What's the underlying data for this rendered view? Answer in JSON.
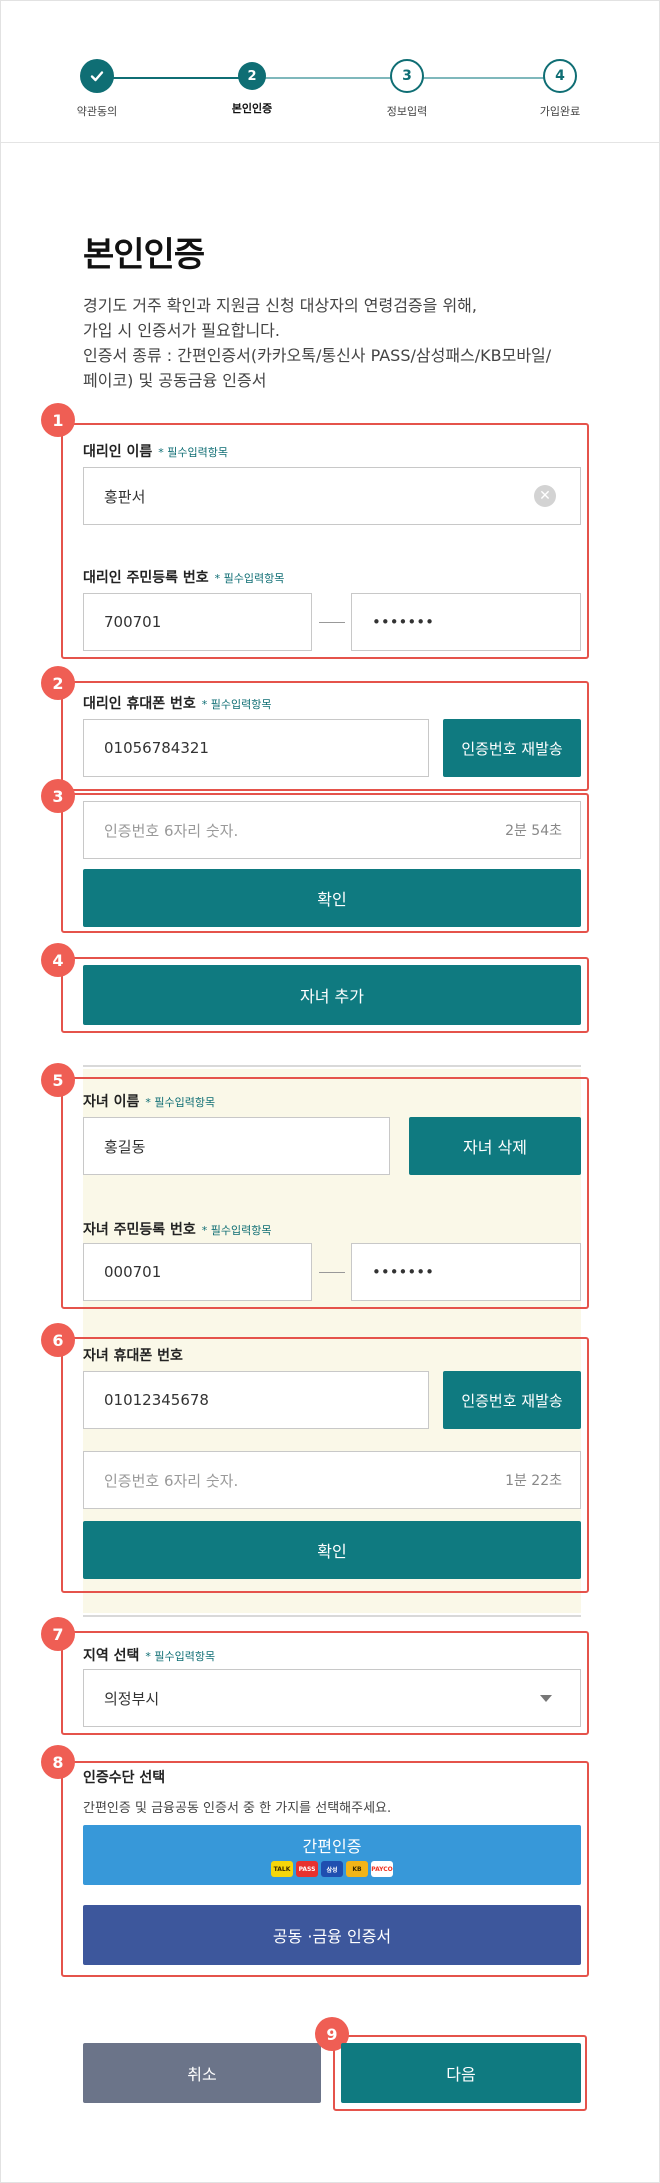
{
  "stepper": {
    "steps": [
      {
        "num": "",
        "label": "약관동의"
      },
      {
        "num": "2",
        "label": "본인인증"
      },
      {
        "num": "3",
        "label": "정보입력"
      },
      {
        "num": "4",
        "label": "가입완료"
      }
    ]
  },
  "page": {
    "title": "본인인증",
    "desc_line1": "경기도 거주 확인과 지원금 신청 대상자의 연령검증을 위해,",
    "desc_line2": "가입 시 인증서가 필요합니다.",
    "desc_line3": "인증서 종류 : 간편인증서(카카오톡/통신사 PASS/삼성패스/KB모바일/",
    "desc_line4": "페이코) 및 공동금융 인증서"
  },
  "badges": [
    "1",
    "2",
    "3",
    "4",
    "5",
    "6",
    "7",
    "8",
    "9"
  ],
  "required_text": "필수입력항목",
  "agent": {
    "name_label": "대리인 이름",
    "name_value": "홍판서",
    "rrn_label": "대리인 주민등록 번호",
    "rrn_front": "700701",
    "rrn_back": "•••••••",
    "phone_label": "대리인 휴대폰 번호",
    "phone_value": "01056784321",
    "resend_label": "인증번호 재발송",
    "code_placeholder": "인증번호 6자리 숫자.",
    "timer": "2분 54초",
    "confirm_label": "확인",
    "add_child_label": "자녀 추가"
  },
  "child": {
    "name_label": "자녀 이름",
    "name_value": "홍길동",
    "delete_label": "자녀 삭제",
    "rrn_label": "자녀 주민등록 번호",
    "rrn_front": "000701",
    "rrn_back": "•••••••",
    "phone_label": "자녀 휴대폰 번호",
    "phone_value": "01012345678",
    "resend_label": "인증번호 재발송",
    "code_placeholder": "인증번호 6자리 숫자.",
    "timer": "1분 22초",
    "confirm_label": "확인"
  },
  "region": {
    "label": "지역 선택",
    "value": "의정부시"
  },
  "auth": {
    "label": "인증수단 선택",
    "desc": "간편인증 및 금융공동 인증서 중 한 가지를 선택해주세요.",
    "easy_label": "간편인증",
    "easy_icons": [
      "TALK",
      "PASS",
      "삼성",
      "KB",
      "PAYCO"
    ],
    "cert_label": "공동 ·금융 인증서"
  },
  "footer": {
    "cancel_label": "취소",
    "next_label": "다음"
  },
  "colors": {
    "teal": "#0f7a80",
    "annotation_red": "#e5534b",
    "easy_blue": "#3798d9",
    "cert_navy": "#3d579c",
    "cancel_gray": "#6b7489"
  }
}
